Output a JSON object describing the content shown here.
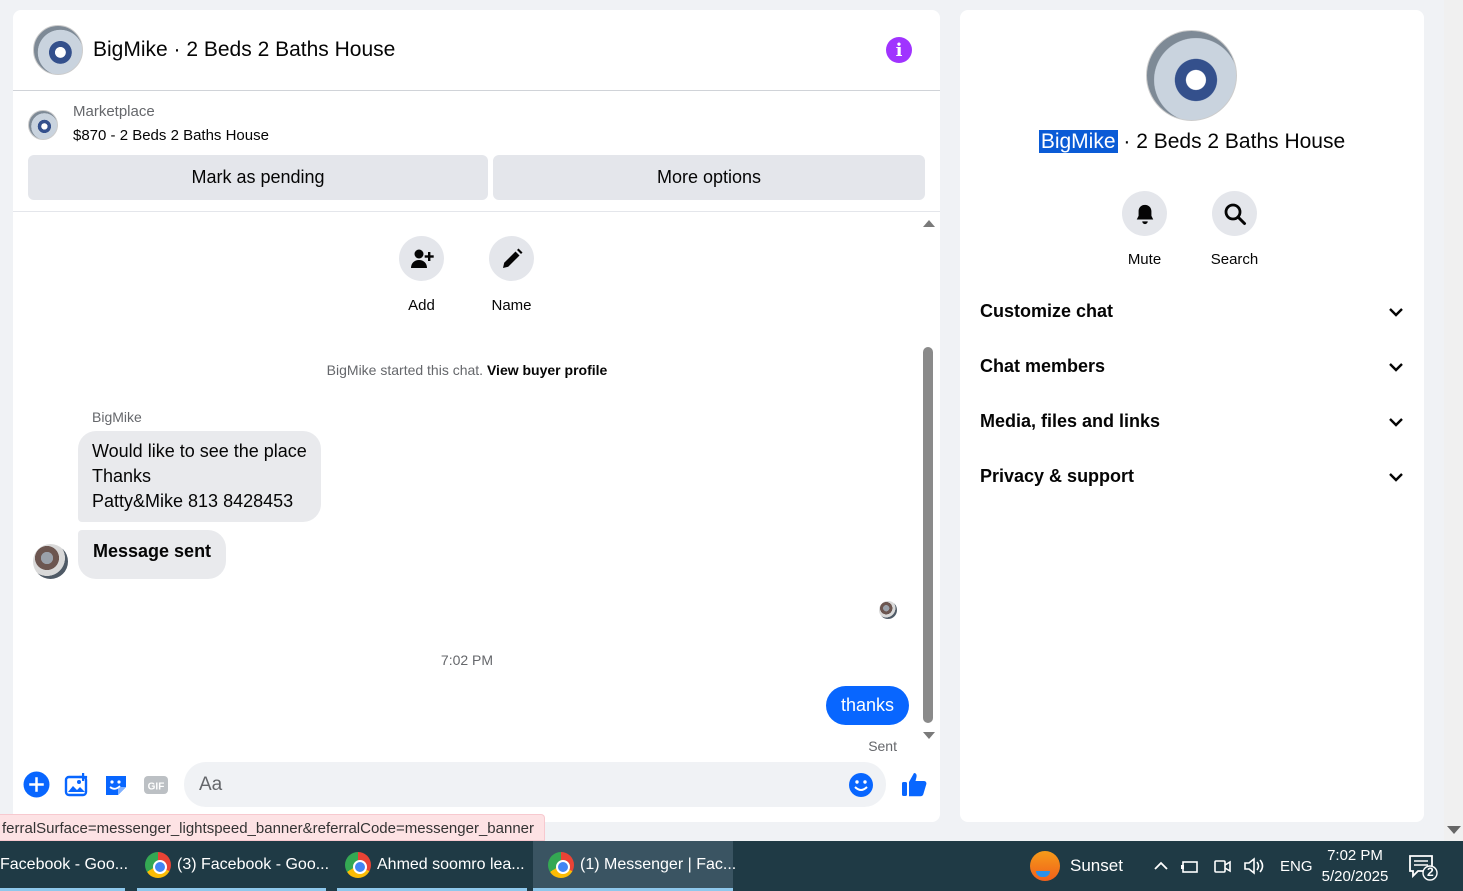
{
  "chat": {
    "title": "BigMike · 2 Beds 2 Baths House",
    "marketplace": {
      "label": "Marketplace",
      "listing": "$870 - 2 Beds 2 Baths House",
      "pending_button": "Mark as pending",
      "more_button": "More options"
    },
    "actions": {
      "add_label": "Add",
      "name_label": "Name"
    },
    "started_text": "BigMike started this chat.",
    "view_profile": "View buyer profile",
    "sender_name": "BigMike",
    "incoming": {
      "line1": "Would like to see the place",
      "line2": "Thanks",
      "line3": "Patty&Mike 813 8428453",
      "message_sent": "Message sent"
    },
    "timestamp": "7:02 PM",
    "outgoing": {
      "text": "thanks",
      "status": "Sent"
    },
    "composer": {
      "placeholder": "Aa"
    }
  },
  "info_panel": {
    "title_highlight": "BigMike",
    "title_rest": " · 2 Beds 2 Baths House",
    "mute_label": "Mute",
    "search_label": "Search",
    "sections": [
      "Customize chat",
      "Chat members",
      "Media, files and links",
      "Privacy & support"
    ]
  },
  "status_url": "ferralSurface=messenger_lightspeed_banner&referralCode=messenger_banner",
  "taskbar": {
    "items": [
      "Facebook - Goo...",
      "(3) Facebook - Goo...",
      "Ahmed soomro lea...",
      "(1) Messenger | Fac..."
    ],
    "weather": "Sunset",
    "language": "ENG",
    "time": "7:02 PM",
    "date": "5/20/2025",
    "notification_count": "2"
  },
  "colors": {
    "accent": "#0866ff",
    "info": "#a033ff",
    "taskbar": "#1f3a45"
  }
}
